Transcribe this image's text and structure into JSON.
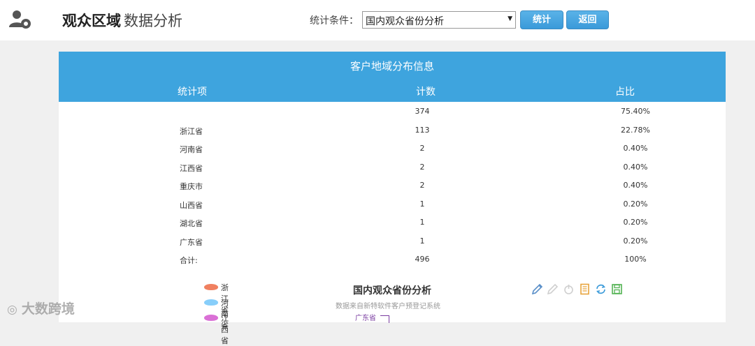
{
  "header": {
    "title_main": "观众区域",
    "title_sub": "数据分析",
    "filter_label": "统计条件：",
    "filter_value": "国内观众省份分析",
    "stat_button": "统计",
    "back_button": "返回"
  },
  "table": {
    "title": "客户地域分布信息",
    "columns": [
      "统计项",
      "计数",
      "占比"
    ],
    "rows": [
      {
        "name": "",
        "count": "374",
        "pct": "75.40%"
      },
      {
        "name": "浙江省",
        "count": "113",
        "pct": "22.78%"
      },
      {
        "name": "河南省",
        "count": "2",
        "pct": "0.40%"
      },
      {
        "name": "江西省",
        "count": "2",
        "pct": "0.40%"
      },
      {
        "name": "重庆市",
        "count": "2",
        "pct": "0.40%"
      },
      {
        "name": "山西省",
        "count": "1",
        "pct": "0.20%"
      },
      {
        "name": "湖北省",
        "count": "1",
        "pct": "0.20%"
      },
      {
        "name": "广东省",
        "count": "1",
        "pct": "0.20%"
      },
      {
        "name": "合计:",
        "count": "496",
        "pct": "100%"
      }
    ]
  },
  "map": {
    "title": "国内观众省份分析",
    "subtitle": "数据来自新特软件客户预登记系统",
    "region_label": "广东省",
    "legend": [
      {
        "label": "浙江省",
        "color": "#f08060"
      },
      {
        "label": "河南省",
        "color": "#87cefa"
      },
      {
        "label": "江西省",
        "color": "#da70d6"
      }
    ],
    "tools": [
      "pencil-icon",
      "eraser-icon",
      "power-icon",
      "document-icon",
      "refresh-icon",
      "save-icon"
    ]
  },
  "colors": {
    "header_blue": "#3ea4de",
    "button_blue": "#3a9ad9"
  },
  "watermark": "大数跨境"
}
